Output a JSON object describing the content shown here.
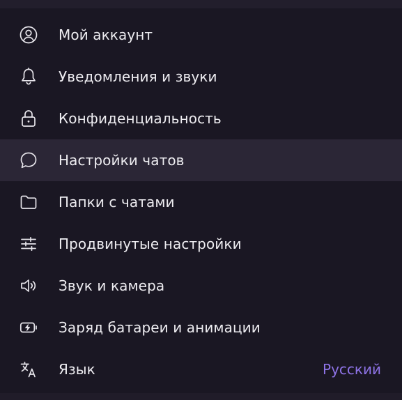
{
  "menu": {
    "items": [
      {
        "label": "Мой аккаунт",
        "icon": "account-circle-icon"
      },
      {
        "label": "Уведомления и звуки",
        "icon": "bell-icon"
      },
      {
        "label": "Конфиденциальность",
        "icon": "lock-icon"
      },
      {
        "label": "Настройки чатов",
        "icon": "chat-bubble-icon"
      },
      {
        "label": "Папки с чатами",
        "icon": "folder-icon"
      },
      {
        "label": "Продвинутые настройки",
        "icon": "sliders-icon"
      },
      {
        "label": "Звук и камера",
        "icon": "speaker-icon"
      },
      {
        "label": "Заряд батареи и анимации",
        "icon": "battery-charge-icon"
      },
      {
        "label": "Язык",
        "icon": "translate-icon",
        "value": "Русский"
      }
    ]
  },
  "colors": {
    "background": "#1a1723",
    "hover": "#2b2636",
    "text": "#eeedf1",
    "accent": "#8f74e8"
  }
}
